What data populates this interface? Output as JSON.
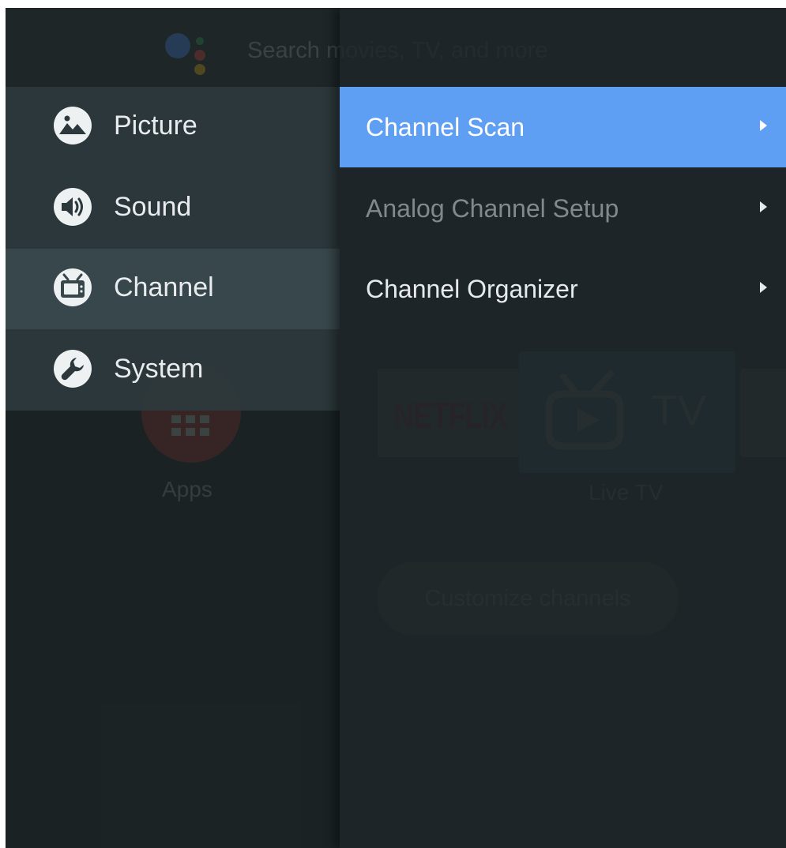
{
  "launcher": {
    "search_placeholder": "Search movies, TV, and more",
    "apps_label": "Apps",
    "netflix_label": "NETFLIX",
    "livetv_tile_text": "TV",
    "livetv_label": "Live TV",
    "customize_label": "Customize channels"
  },
  "settings_menu": {
    "items": [
      {
        "label": "Picture",
        "icon": "picture-icon",
        "selected": false
      },
      {
        "label": "Sound",
        "icon": "sound-icon",
        "selected": false
      },
      {
        "label": "Channel",
        "icon": "tv-icon",
        "selected": true
      },
      {
        "label": "System",
        "icon": "wrench-icon",
        "selected": false
      }
    ]
  },
  "channel_submenu": {
    "items": [
      {
        "label": "Channel Scan",
        "state": "focused",
        "icon": "chevron-right-icon"
      },
      {
        "label": "Analog Channel Setup",
        "state": "disabled",
        "icon": "chevron-right-icon"
      },
      {
        "label": "Channel Organizer",
        "state": "normal",
        "icon": "chevron-right-icon"
      }
    ]
  },
  "colors": {
    "focus_highlight": "#5f9ff3",
    "selected_item": "#38474c",
    "panel_background": "#2c383c",
    "screen_background": "#1e2628"
  }
}
